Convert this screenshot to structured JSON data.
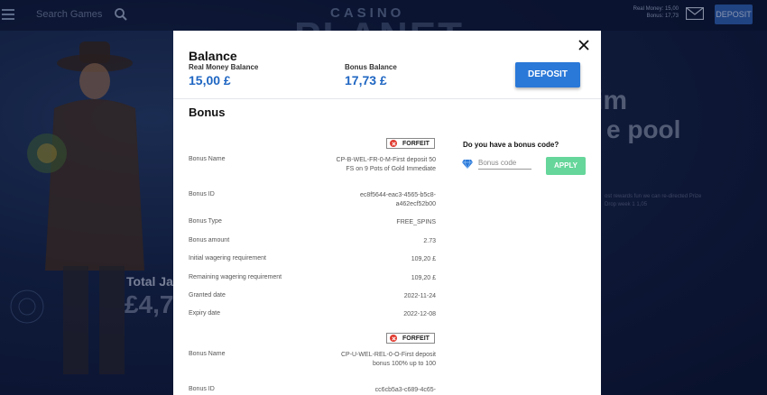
{
  "background": {
    "search_placeholder": "Search Games",
    "logo_top": "CASINO",
    "logo_big": "PLANET",
    "account_lines": [
      "Real Money: 15,00",
      "Bonus: 17,73"
    ],
    "deposit_label": "DEPOSIT",
    "promo_line1": "im",
    "promo_line2": "e pool",
    "promo_small": "ost rewards fun we can re-directed Prize Drop week 1 1,05",
    "jackpot_label": "Total Jac",
    "jackpot_value": "£4,7"
  },
  "modal": {
    "title": "Balance",
    "real_money_label": "Real Money Balance",
    "real_money_value": "15,00 £",
    "bonus_balance_label": "Bonus Balance",
    "bonus_balance_value": "17,73 £",
    "deposit_label": "DEPOSIT",
    "bonus_section_title": "Bonus",
    "forfeit_label": "FORFEIT",
    "bonus_code_question": "Do you have a bonus code?",
    "bonus_code_placeholder": "Bonus code",
    "apply_label": "APPLY",
    "bonus1": [
      {
        "label": "Bonus Name",
        "value": "CP-B-WEL-FR-0-M-First deposit 50 FS on 9 Pots of Gold Immediate"
      },
      {
        "label": "Bonus ID",
        "value": "ec8f5644-eac3-4565-b5c8-a462ecf52b00"
      },
      {
        "label": "Bonus Type",
        "value": "FREE_SPINS"
      },
      {
        "label": "Bonus amount",
        "value": "2.73"
      },
      {
        "label": "Initial wagering requirement",
        "value": "109,20 £"
      },
      {
        "label": "Remaining wagering requirement",
        "value": "109,20 £"
      },
      {
        "label": "Granted date",
        "value": "2022-11-24"
      },
      {
        "label": "Expiry date",
        "value": "2022-12-08"
      }
    ],
    "bonus2": [
      {
        "label": "Bonus Name",
        "value": "CP-U-WEL-REL-0-O-First deposit bonus 100% up to 100"
      },
      {
        "label": "Bonus ID",
        "value": "cc6cb5a3-c689-4c65-"
      }
    ]
  },
  "colors": {
    "accent": "#2a78d8",
    "balance_text": "#1f66c2",
    "apply": "#66d69a",
    "forfeit_icon": "#e03a2f"
  }
}
